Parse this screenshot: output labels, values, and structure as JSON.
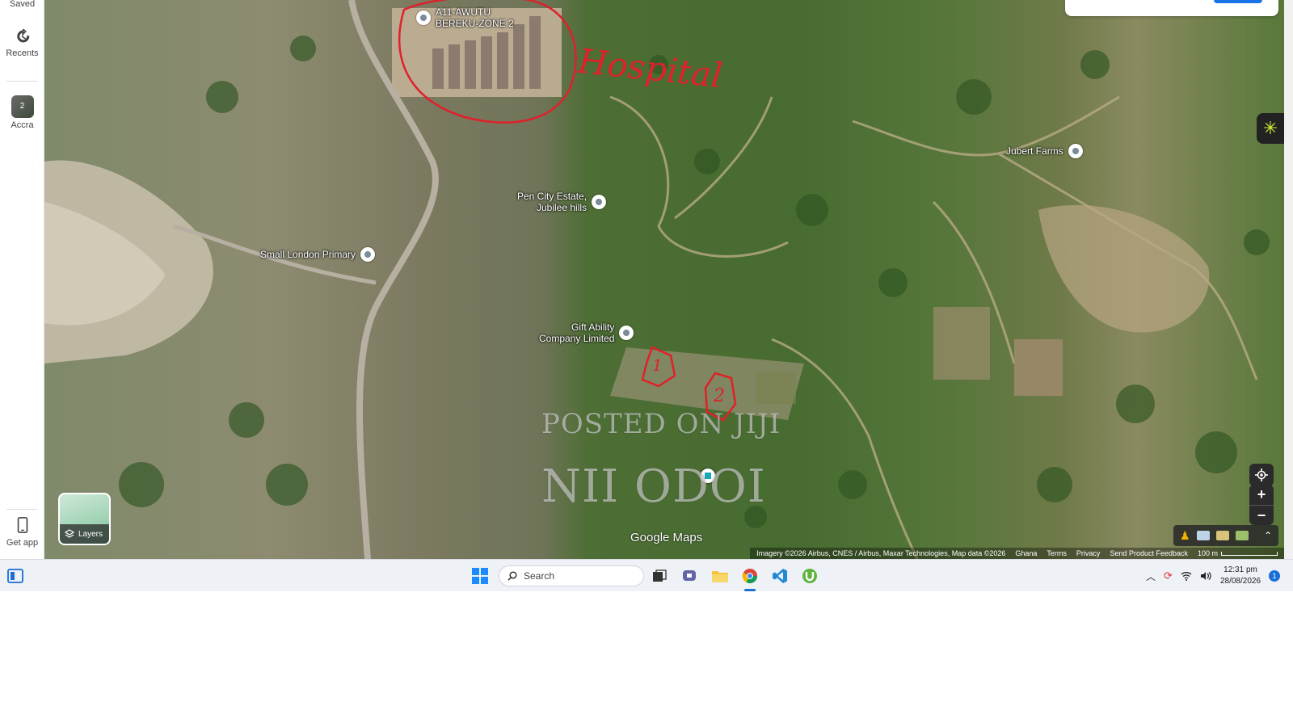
{
  "sidebar": {
    "items": [
      {
        "label": "Saved",
        "icon": "bookmark-icon"
      },
      {
        "label": "Recents",
        "icon": "history-icon"
      },
      {
        "label": "Accra",
        "icon": "place-thumbnail",
        "badge": "2"
      },
      {
        "label": "Get app",
        "icon": "phone-icon"
      }
    ]
  },
  "map": {
    "pois": [
      {
        "label": "A11-AWUTU\nBEREKU-ZONE 2"
      },
      {
        "label": "Pen City Estate,\nJubilee hills"
      },
      {
        "label": "Small London Primary"
      },
      {
        "label": "Gift Ability\nCompany Limited"
      },
      {
        "label": "Jubert Farms"
      }
    ],
    "annotations": {
      "hospital_text": "Hospital",
      "plot_1": "1",
      "plot_2": "2"
    },
    "watermark_top": "POSTED ON JIJI",
    "watermark_bottom": "NII ODOI",
    "logo": "Google Maps",
    "layers_label": "Layers",
    "attribution": {
      "imagery": "Imagery ©2026 Airbus, CNES / Airbus, Maxar Technologies, Map data ©2026",
      "country": "Ghana",
      "terms": "Terms",
      "privacy": "Privacy",
      "feedback": "Send Product Feedback",
      "scale": "100 m"
    }
  },
  "taskbar": {
    "search_placeholder": "Search",
    "time": "12:31 pm",
    "date": "28/08/2026",
    "notification_count": "1"
  },
  "colors": {
    "accent": "#1a73e8",
    "annotation_red": "#e0202a",
    "taskbar_bg": "#eef1f6"
  }
}
